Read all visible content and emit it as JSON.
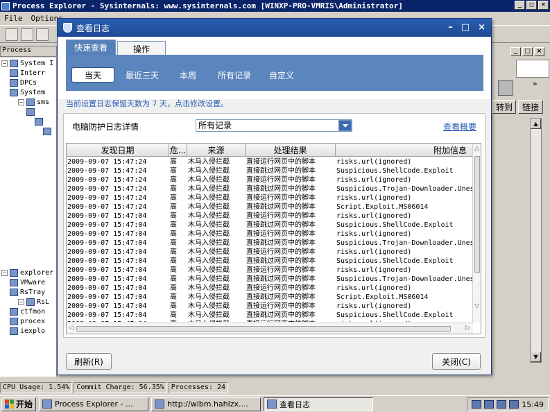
{
  "background_app": {
    "title": "Process Explorer - Sysinternals: www.sysinternals.com [WINXP-PRO-VMRIS\\Administrator]",
    "menu": [
      "File",
      "Options",
      "View",
      "Process",
      "Find",
      "Users",
      "Help"
    ],
    "process_header": "Process",
    "tree": [
      {
        "label": "System I",
        "indent": 0
      },
      {
        "label": "Interr",
        "indent": 1
      },
      {
        "label": "DPCs",
        "indent": 1
      },
      {
        "label": "System",
        "indent": 1
      },
      {
        "label": "sms",
        "indent": 2
      },
      {
        "label": "",
        "indent": 3
      },
      {
        "label": "",
        "indent": 4
      },
      {
        "label": "",
        "indent": 5
      },
      {
        "label": "explorer",
        "indent": 0
      },
      {
        "label": "VMware",
        "indent": 1
      },
      {
        "label": "RsTray",
        "indent": 1
      },
      {
        "label": "RsL",
        "indent": 2
      },
      {
        "label": "ctfmon",
        "indent": 1
      },
      {
        "label": "procex",
        "indent": 1
      },
      {
        "label": "iexplo",
        "indent": 1
      }
    ],
    "right_buttons": {
      "goto": "转到",
      "links": "链接"
    },
    "status": {
      "cpu": "CPU Usage: 1.54%",
      "commit": "Commit Charge: 56.35%",
      "processes": "Processes: 24"
    }
  },
  "taskbar": {
    "start": "开始",
    "tasks": [
      {
        "label": "Process Explorer - ...",
        "active": false
      },
      {
        "label": "http://wlbm.hahlzx....",
        "active": false
      },
      {
        "label": "查看日志",
        "active": true
      }
    ],
    "clock": "15:49"
  },
  "dialog": {
    "title": "查看日志",
    "tabs": [
      "快速查看",
      "操作"
    ],
    "active_tab": 0,
    "filters": [
      "当天",
      "最近三天",
      "本周",
      "所有记录",
      "自定义"
    ],
    "selected_filter": 0,
    "notice": "当前设置日志保留天数为 7 天，点击修改设置。",
    "detail_label": "电脑防护日志详情",
    "record_select": "所有记录",
    "summary_link": "查看概要",
    "columns": [
      "发现日期",
      "危...",
      "来源",
      "处理结果",
      "附加信息"
    ],
    "rows": [
      [
        "2009-09-07 15:47:24",
        "高",
        "木马入侵拦截",
        "直接运行网页中的脚本",
        "risks.url(ignored)"
      ],
      [
        "2009-09-07 15:47:24",
        "高",
        "木马入侵拦截",
        "直接跳过网页中的脚本",
        "Suspicious.ShellCode.Exploit"
      ],
      [
        "2009-09-07 15:47:24",
        "高",
        "木马入侵拦截",
        "直接运行网页中的脚本",
        "risks.url(ignored)"
      ],
      [
        "2009-09-07 15:47:24",
        "高",
        "木马入侵拦截",
        "直接跳过网页中的脚本",
        "Suspicious.Trojan-Downloader.Unes"
      ],
      [
        "2009-09-07 15:47:24",
        "高",
        "木马入侵拦截",
        "直接运行网页中的脚本",
        "risks.url(ignored)"
      ],
      [
        "2009-09-07 15:47:24",
        "高",
        "木马入侵拦截",
        "直接跳过网页中的脚本",
        "Script.Exploit.MS06014"
      ],
      [
        "2009-09-07 15:47:04",
        "高",
        "木马入侵拦截",
        "直接运行网页中的脚本",
        "risks.url(ignored)"
      ],
      [
        "2009-09-07 15:47:04",
        "高",
        "木马入侵拦截",
        "直接跳过网页中的脚本",
        "Suspicious.ShellCode.Exploit"
      ],
      [
        "2009-09-07 15:47:04",
        "高",
        "木马入侵拦截",
        "直接运行网页中的脚本",
        "risks.url(ignored)"
      ],
      [
        "2009-09-07 15:47:04",
        "高",
        "木马入侵拦截",
        "直接跳过网页中的脚本",
        "Suspicious.Trojan-Downloader.Unes"
      ],
      [
        "2009-09-07 15:47:04",
        "高",
        "木马入侵拦截",
        "直接运行网页中的脚本",
        "risks.url(ignored)"
      ],
      [
        "2009-09-07 15:47:04",
        "高",
        "木马入侵拦截",
        "直接跳过网页中的脚本",
        "Suspicious.ShellCode.Exploit"
      ],
      [
        "2009-09-07 15:47:04",
        "高",
        "木马入侵拦截",
        "直接运行网页中的脚本",
        "risks.url(ignored)"
      ],
      [
        "2009-09-07 15:47:04",
        "高",
        "木马入侵拦截",
        "直接跳过网页中的脚本",
        "Suspicious.Trojan-Downloader.Unes"
      ],
      [
        "2009-09-07 15:47:04",
        "高",
        "木马入侵拦截",
        "直接运行网页中的脚本",
        "risks.url(ignored)"
      ],
      [
        "2009-09-07 15:47:04",
        "高",
        "木马入侵拦截",
        "直接跳过网页中的脚本",
        "Script.Exploit.MS06014"
      ],
      [
        "2009-09-07 15:47:04",
        "高",
        "木马入侵拦截",
        "直接运行网页中的脚本",
        "risks.url(ignored)"
      ],
      [
        "2009-09-07 15:47:04",
        "高",
        "木马入侵拦截",
        "直接跳过网页中的脚本",
        "Suspicious.ShellCode.Exploit"
      ],
      [
        "2009-09-07 15:47:04",
        "高",
        "木马入侵拦截",
        "直接运行网页中的脚本",
        "risks.url(ignored)"
      ]
    ],
    "refresh_button": "刷新(R)",
    "close_button": "关闭(C)"
  },
  "colors": {
    "dialog_title": "#1e4a96",
    "filter_bar": "#5b86bd",
    "link": "#2b5bb3",
    "xp_titlebar": "#0a246a"
  }
}
